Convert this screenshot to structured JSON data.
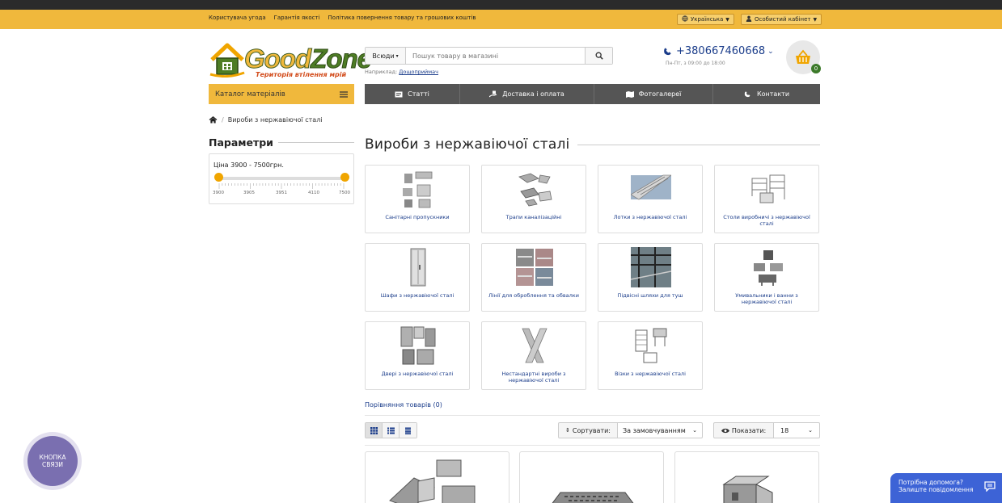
{
  "topbar": {
    "links": [
      "Користувача угода",
      "Гарантія якості",
      "Політика повернення товару та грошових коштів"
    ],
    "language": "Українська",
    "account": "Особистий кабінет"
  },
  "logo": {
    "word1": "Good",
    "word2": "Zone",
    "tagline": "Територія втілення мрій"
  },
  "search": {
    "scope": "Всюди",
    "placeholder": "Пошук товару в магазині",
    "example_prefix": "Наприклад:",
    "example_link": "Дощоприймач"
  },
  "contact": {
    "phone": "+380667460668",
    "hours": "Пн-Пт, з 09:00 до 18:00"
  },
  "cart": {
    "count": "0"
  },
  "catalog_button": "Каталог матеріалів",
  "menu": [
    "Статті",
    "Доставка і оплата",
    "Фотогалереї",
    "Контакти"
  ],
  "breadcrumb": {
    "current": "Вироби з нержавіючої сталі"
  },
  "filters": {
    "title": "Параметри",
    "price_label": "Ціна 3900 - 7500грн.",
    "ticks": [
      "3900",
      "3905",
      "3951",
      "4110",
      "7500"
    ],
    "range": {
      "min": 3900,
      "max": 7500,
      "from": 3900,
      "to": 7500
    }
  },
  "page_title": "Вироби з нержавіючої сталі",
  "categories": [
    "Санітарні пропускники",
    "Трапи каналізаційні",
    "Лотки з нержавіючої сталі",
    "Столи виробничі з нержавіючої сталі",
    "Шафи з нержавіючої сталі",
    "Лінії для оброблення та обвалки",
    "Підвісні шляхи для туш",
    "Умивальники і ванни з нержавіючої сталі",
    "Двері з нержавіючої сталі",
    "Нестандартні вироби з нержавіючої сталі",
    "Візки з нержавіючої сталі"
  ],
  "compare_link": "Порівняння товарів (0)",
  "toolbar": {
    "sort_label": "Сортувати:",
    "sort_value": "За замовчуванням",
    "show_label": "Показати:",
    "show_value": "18"
  },
  "widgets": {
    "contact_button": "КНОПКА СВЯЗИ",
    "help_line1": "Потрібна допомога?",
    "help_line2": "Залиште повідомлення"
  },
  "colors": {
    "accent": "#f0b83c",
    "menu": "#555555",
    "link": "#1a3c8a",
    "badge": "#3c7a2a",
    "help": "#3d63d6"
  }
}
